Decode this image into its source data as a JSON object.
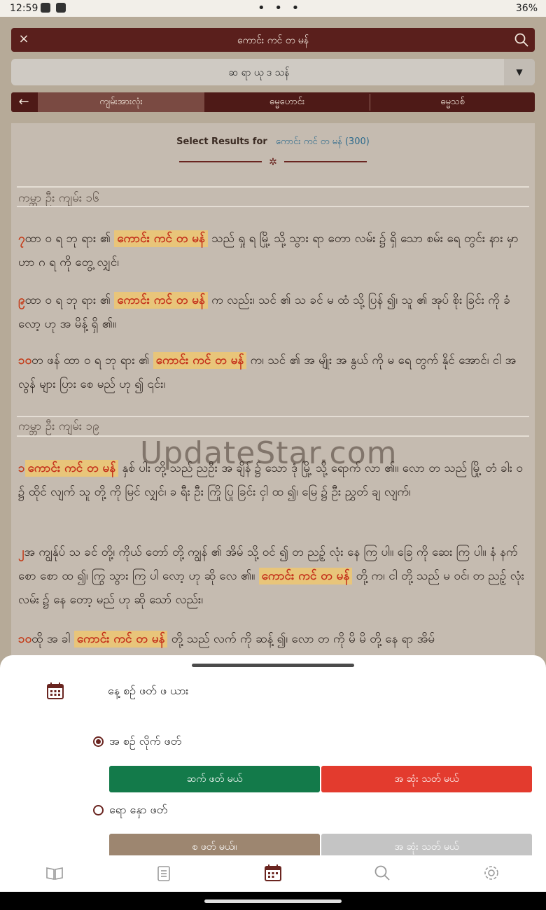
{
  "status_bar": {
    "time": "12:59",
    "center": "• • •",
    "battery": "36%"
  },
  "search": {
    "query": "ကောင်း ကင် တ မန်"
  },
  "book_select": {
    "value": "ဆ ရာ ယု ဒ သန်"
  },
  "tabs": [
    {
      "label": "ကျမ်းအားလုံး",
      "active": true
    },
    {
      "label": "ဓမ္မဟောင်း",
      "active": false
    },
    {
      "label": "ဓမ္မသစ်",
      "active": false
    }
  ],
  "results": {
    "header_label": "Select Results for",
    "header_query": "ကောင်း ကင် တ မန် (300)",
    "sections": [
      {
        "title": "ကမ္ဘာ ဦး ကျမ်း ၁၆",
        "verses": [
          {
            "num": "၇",
            "pre": "ထာ ဝ ရ ဘု ရား ၏",
            "hl": "ကောင်း ကင် တ မန်",
            "post": "သည် ရှု ရ မြို့ သို့ သွား ရာ တော လမ်း ၌ ရှိ သော စမ်း ရေ တွင်း နား မှာ ဟာ ဂ ရ ကို တွေ့ လျှင်၊"
          },
          {
            "num": "၉",
            "pre": "ထာ ဝ ရ ဘု ရား ၏",
            "hl": "ကောင်း ကင် တ မန်",
            "post": "က လည်း၊ သင် ၏ သ ခင် မ ထံ သို့ ပြန် ၍၊ သူ ၏ အုပ် စိုး ခြင်း ကို ခံ လော့ ဟု အ မိန့် ရှိ ၏။"
          },
          {
            "num": "၁၀",
            "pre": "တ ဖန် ထာ ဝ ရ ဘု ရား ၏",
            "hl": "ကောင်း ကင် တ မန်",
            "post": "က၊ သင် ၏ အ မျိုး အ နွယ် ကို မ ရေ တွက် နိုင် အောင်၊ ငါ အ လွန် များ ပြား စေ မည် ဟု ၍ ၎င်း၊"
          }
        ]
      },
      {
        "title": "ကမ္ဘာ ဦး ကျမ်း ၁၉",
        "verses": [
          {
            "num": "၁",
            "pre": "",
            "hl": "ကောင်း ကင် တ မန်",
            "post": "နှစ် ပါး တို့ သည် ညဦး အ ချိန် ၌ သော ဒုံ မြို့ သို့ ရောက် လာ ၏။ လော တ သည် မြို့ တံ ခါး ဝ ၌ ထိုင် လျက် သူ တို့ ကို မြင် လျှင်၊ ခ ရီး ဦး ကြို ပြု ခြင်း ငှါ ထ ၍၊ မြေ ၌ ဦး ညွှတ် ချ လျက်၊"
          },
          {
            "num": "၂",
            "pre": "အ ကျွန်ုပ် သ ခင် တို့၊ ကိုယ် တော် တို့ ကျွန် ၏ အိမ် သို့ ဝင် ၍ တ ညဉ့် လုံး နေ ကြ ပါ။ ခြေ ကို ဆေး ကြ ပါ။ နံ နက် စော စော ထ ၍၊ ကြွ သွား ကြ ပါ လော့ ဟု ဆို လေ ၏။",
            "hl": "ကောင်း ကင် တ မန်",
            "post": "တို့ က၊ ငါ တို့ သည် မ ဝင်၊ တ ညဉ့် လုံး လမ်း ၌ နေ တော့ မည် ဟု ဆို သော် လည်း၊"
          },
          {
            "num": "၁၀",
            "pre": "ထို အ ခါ",
            "hl": "ကောင်း ကင် တ မန်",
            "post": "တို့ သည် လက် ကို ဆန့် ၍၊ လော တ ကို မိ မိ တို့ နေ ရာ အိမ်"
          }
        ]
      }
    ]
  },
  "watermark": "UpdateStar.com",
  "sheet": {
    "heading": "နေ့ စဉ် ဖတ် ဖ ယား",
    "option1": {
      "label": "အ စဉ် လိုက် ဖတ်",
      "selected": true,
      "btn_left": "ဆက် ဖတ် မယ်",
      "btn_right": "အ ဆုံး သတ် မယ်"
    },
    "option2": {
      "label": "ရော နှော ဖတ်",
      "selected": false,
      "btn_left": "စ ဖတ် မယ်။",
      "btn_right": "အ ဆုံး သတ် မယ်"
    }
  },
  "colors": {
    "maroon": "#5a1f1c",
    "green": "#137a4a",
    "red": "#e33b2e",
    "tan": "#9d8670",
    "gray": "#c4c4c4"
  },
  "icons": {
    "nav": [
      "book-icon",
      "notes-icon",
      "calendar-icon",
      "search-icon",
      "settings-icon"
    ]
  }
}
